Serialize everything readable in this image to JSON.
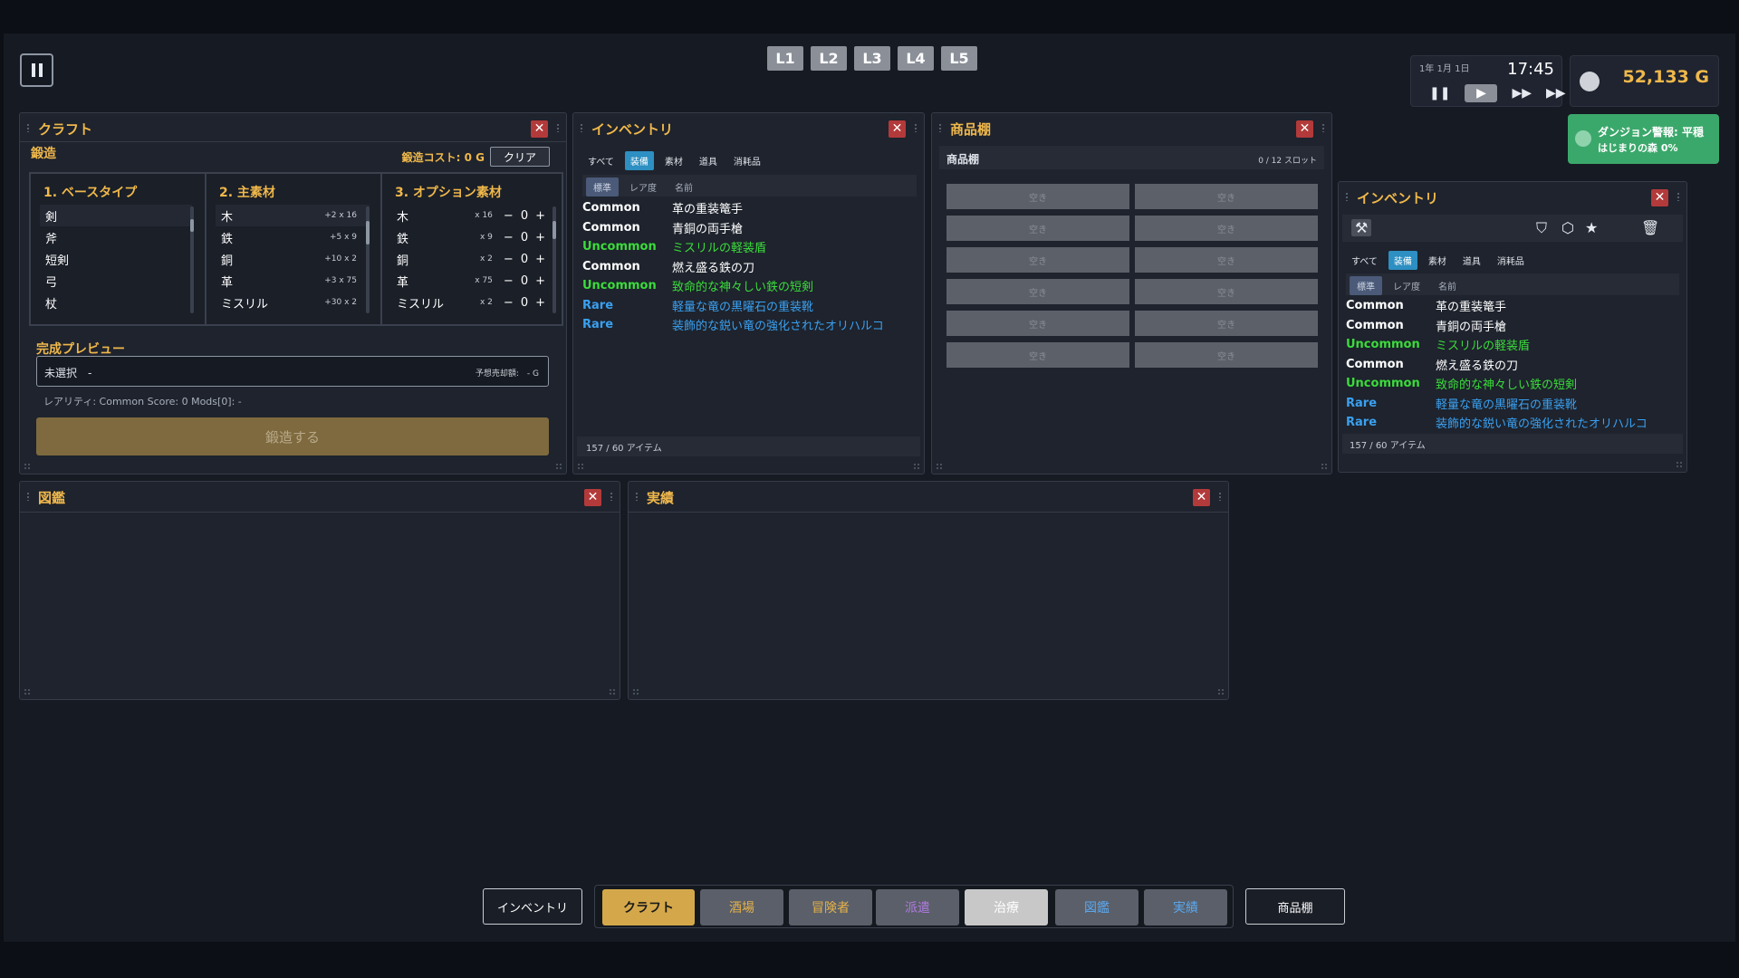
{
  "layouts": [
    "L1",
    "L2",
    "L3",
    "L4",
    "L5"
  ],
  "clock": {
    "date": "1年 1月 1日",
    "time": "17:45"
  },
  "gold": {
    "amount": "52,133 G"
  },
  "dungeon": {
    "line1": "ダンジョン警報: 平穏",
    "line2": "はじまりの森 0%"
  },
  "craft": {
    "title": "クラフト",
    "section": "鍛造",
    "cost": "鍛造コスト: 0 G",
    "clear": "クリア",
    "col1_title": "1. ベースタイプ",
    "col2_title": "2. 主素材",
    "col3_title": "3. オプション素材",
    "base_types": [
      "剣",
      "斧",
      "短剣",
      "弓",
      "杖"
    ],
    "main_materials": [
      {
        "name": "木",
        "meta": "+2 x 16"
      },
      {
        "name": "鉄",
        "meta": "+5 x 9"
      },
      {
        "name": "銅",
        "meta": "+10 x 2"
      },
      {
        "name": "革",
        "meta": "+3 x 75"
      },
      {
        "name": "ミスリル",
        "meta": "+30 x 2"
      }
    ],
    "option_materials": [
      {
        "name": "木",
        "qty": "x 16",
        "count": "0"
      },
      {
        "name": "鉄",
        "qty": "x 9",
        "count": "0"
      },
      {
        "name": "銅",
        "qty": "x 2",
        "count": "0"
      },
      {
        "name": "革",
        "qty": "x 75",
        "count": "0"
      },
      {
        "name": "ミスリル",
        "qty": "x 2",
        "count": "0"
      }
    ],
    "preview_title": "完成プレビュー",
    "preview_value": "未選択　-",
    "preview_price": "予想売却額:　- G",
    "rarity_line": "レアリティ: Common  Score: 0  Mods[0]: -",
    "forge_button": "鍛造する"
  },
  "inventory": {
    "title": "インベントリ",
    "tabs": [
      "すべて",
      "装備",
      "素材",
      "道具",
      "消耗品"
    ],
    "active_tab": "装備",
    "subtabs": [
      "標準",
      "レア度",
      "名前"
    ],
    "items": [
      {
        "rarity": "Common",
        "name": "革の重装篭手"
      },
      {
        "rarity": "Common",
        "name": "青銅の両手槍"
      },
      {
        "rarity": "Uncommon",
        "name": "ミスリルの軽装盾"
      },
      {
        "rarity": "Common",
        "name": "燃え盛る鉄の刀"
      },
      {
        "rarity": "Uncommon",
        "name": "致命的な神々しい鉄の短剣"
      },
      {
        "rarity": "Rare",
        "name": "軽量な竜の黒曜石の重装靴"
      },
      {
        "rarity": "Rare",
        "name": "装飾的な鋭い竜の強化されたオリハルコ"
      }
    ],
    "footer": "157 / 60 アイテム"
  },
  "shop": {
    "title": "商品棚",
    "subtitle": "商品棚",
    "slots_count": "0 / 12 スロット",
    "slot_label": "空き",
    "slots": 12
  },
  "bestiary": {
    "title": "図鑑"
  },
  "achievements": {
    "title": "実績"
  },
  "nav": {
    "left": "インベントリ",
    "right": "商品棚",
    "buttons": [
      {
        "label": "クラフト",
        "color": "#d4a84a",
        "text": "#1a1a1a"
      },
      {
        "label": "酒場",
        "color": "#5a5f69",
        "text": "#e6b24a"
      },
      {
        "label": "冒険者",
        "color": "#5a5f69",
        "text": "#e6b24a"
      },
      {
        "label": "派遣",
        "color": "#5a5f69",
        "text": "#b07ae0"
      },
      {
        "label": "治療",
        "color": "#c8c8c8",
        "text": "#ffffff"
      },
      {
        "label": "図鑑",
        "color": "#5a5f69",
        "text": "#5aa8f0"
      },
      {
        "label": "実績",
        "color": "#5a5f69",
        "text": "#5aa8f0"
      }
    ]
  }
}
